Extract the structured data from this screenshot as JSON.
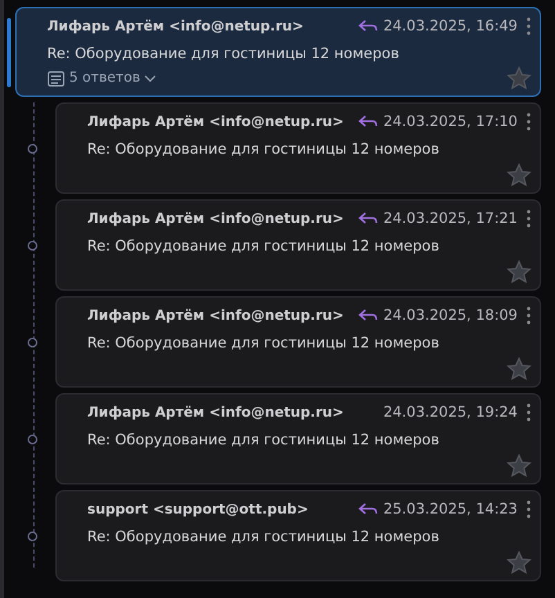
{
  "thread": {
    "sender": "Лифарь Артём <info@netup.ru>",
    "date": "24.03.2025, 16:49",
    "replied": true,
    "subject": "Re: Оборудование для гостиницы 12 номеров",
    "replies_count": "5 ответов",
    "selected": true,
    "starred": false
  },
  "replies": [
    {
      "sender": "Лифарь Артём <info@netup.ru>",
      "date": "24.03.2025, 17:10",
      "replied": true,
      "subject": "Re: Оборудование для гостиницы 12 номеров",
      "selected": false,
      "starred": false
    },
    {
      "sender": "Лифарь Артём <info@netup.ru>",
      "date": "24.03.2025, 17:21",
      "replied": true,
      "subject": "Re: Оборудование для гостиницы 12 номеров",
      "selected": false,
      "starred": false
    },
    {
      "sender": "Лифарь Артём <info@netup.ru>",
      "date": "24.03.2025, 18:09",
      "replied": true,
      "subject": "Re: Оборудование для гостиницы 12 номеров",
      "selected": false,
      "starred": false
    },
    {
      "sender": "Лифарь Артём <info@netup.ru>",
      "date": "24.03.2025, 19:24",
      "replied": false,
      "subject": "Re: Оборудование для гостиницы 12 номеров",
      "selected": false,
      "starred": false
    },
    {
      "sender": "support <support@ott.pub>",
      "date": "25.03.2025, 14:23",
      "replied": true,
      "subject": "Re: Оборудование для гостиницы 12 номеров",
      "selected": false,
      "starred": false
    }
  ]
}
